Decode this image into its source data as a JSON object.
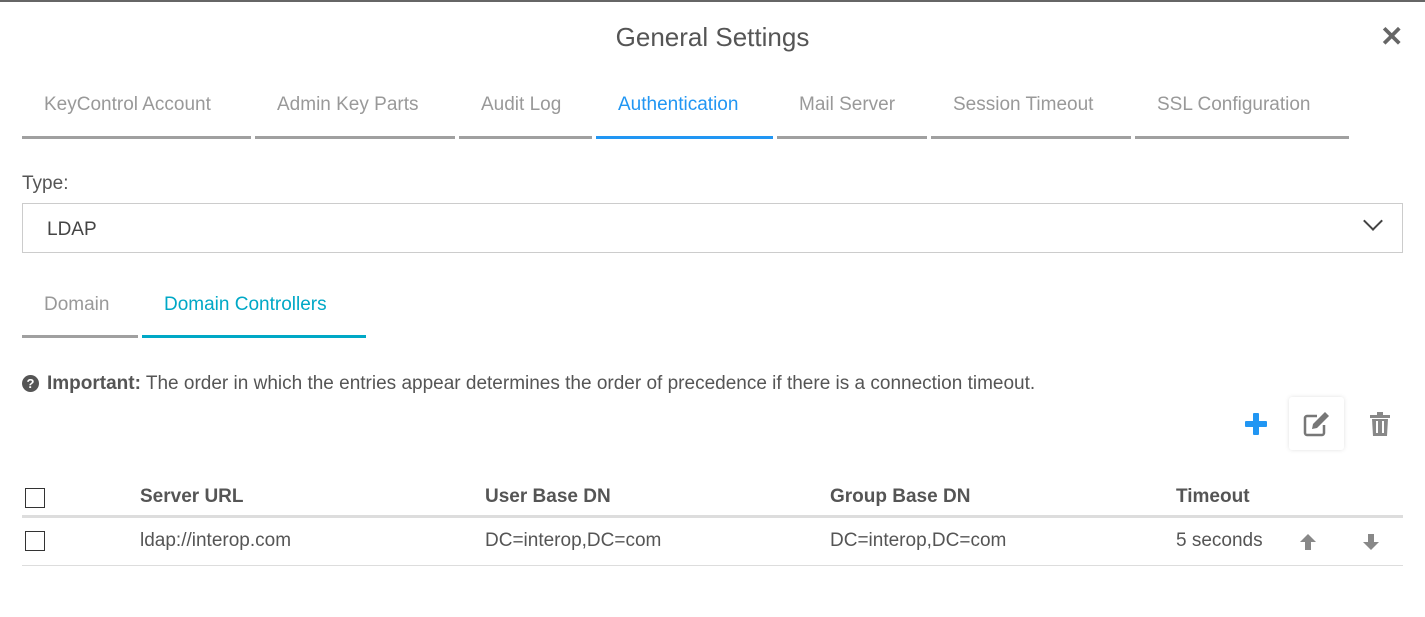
{
  "dialog": {
    "title": "General Settings"
  },
  "tabs": [
    {
      "label": "KeyControl Account"
    },
    {
      "label": "Admin Key Parts"
    },
    {
      "label": "Audit Log"
    },
    {
      "label": "Authentication",
      "active": true
    },
    {
      "label": "Mail Server"
    },
    {
      "label": "Session Timeout"
    },
    {
      "label": "SSL Configuration"
    }
  ],
  "type": {
    "label": "Type:",
    "value": "LDAP"
  },
  "subtabs": [
    {
      "label": "Domain"
    },
    {
      "label": "Domain Controllers",
      "active": true
    }
  ],
  "note": {
    "bold": "Important:",
    "text": " The order in which the entries appear determines the order of precedence if there is a connection timeout."
  },
  "table": {
    "headers": [
      "Server URL",
      "User Base DN",
      "Group Base DN",
      "Timeout"
    ],
    "rows": [
      {
        "server_url": "ldap://interop.com",
        "user_base_dn": "DC=interop,DC=com",
        "group_base_dn": "DC=interop,DC=com",
        "timeout": "5 seconds"
      }
    ]
  },
  "colors": {
    "accent": "#2196f3",
    "subtab_accent": "#00a8c6"
  }
}
